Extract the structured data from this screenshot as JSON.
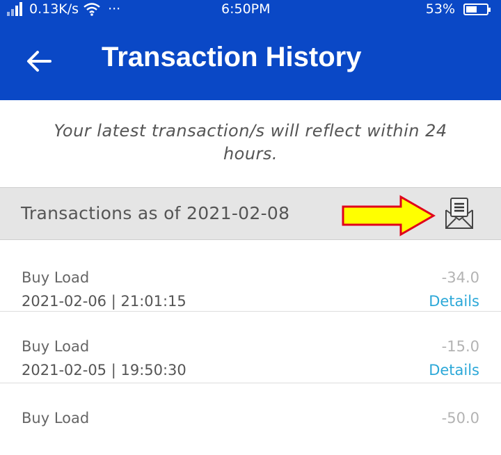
{
  "status_bar": {
    "network_speed": "0.13K/s",
    "more": "···",
    "time": "6:50PM",
    "battery": "53%",
    "battery_level": 0.53
  },
  "app_bar": {
    "title": "Transaction History"
  },
  "notice": {
    "line1": "Your latest transaction/s will reflect within 24",
    "line2": "hours."
  },
  "section": {
    "title": "Transactions as of 2021-02-08"
  },
  "transactions": [
    {
      "type": "Buy Load",
      "datetime": "2021-02-06 | 21:01:15",
      "amount": "-34.0",
      "details_label": "Details"
    },
    {
      "type": "Buy Load",
      "datetime": "2021-02-05 | 19:50:30",
      "amount": "-15.0",
      "details_label": "Details"
    },
    {
      "type": "Buy Load",
      "datetime": "",
      "amount": "-50.0",
      "details_label": ""
    }
  ],
  "colors": {
    "primary": "#0a48c6",
    "link": "#2ca8d8",
    "annotation_fill": "#ffff00",
    "annotation_stroke": "#e0001b"
  }
}
